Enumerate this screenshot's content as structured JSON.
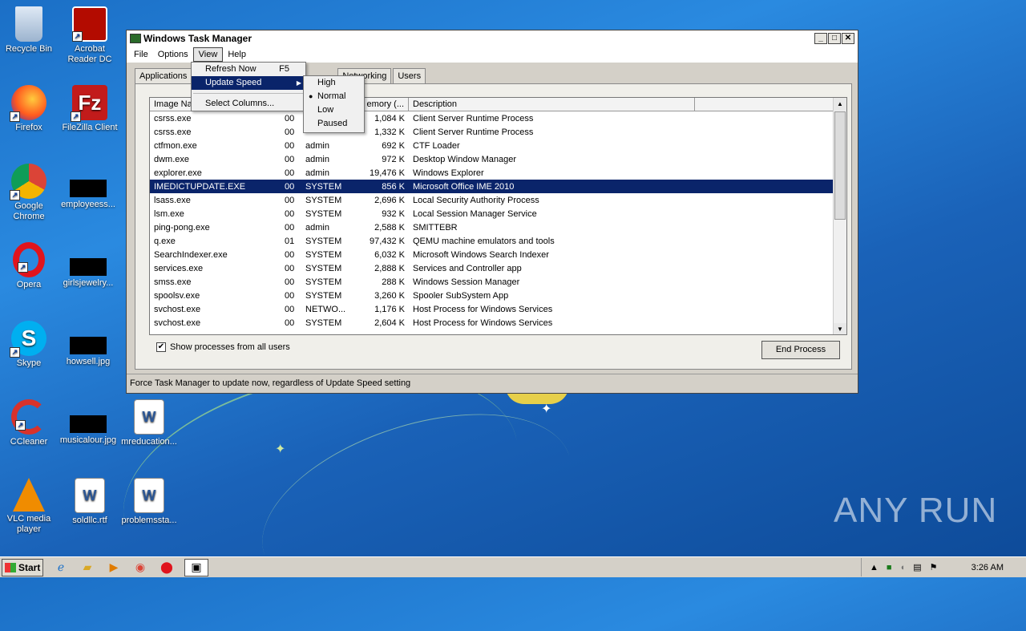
{
  "desktop": {
    "icons": [
      {
        "label": "Recycle Bin"
      },
      {
        "label": "Acrobat Reader DC"
      },
      {
        "label": "Firefox"
      },
      {
        "label": "FileZilla Client"
      },
      {
        "label": "Google Chrome"
      },
      {
        "label": "employeess..."
      },
      {
        "label": "Opera"
      },
      {
        "label": "girlsjewelry..."
      },
      {
        "label": "Skype"
      },
      {
        "label": "howsell.jpg"
      },
      {
        "label": "CCleaner"
      },
      {
        "label": "musicalour.jpg"
      },
      {
        "label": "mreducation..."
      },
      {
        "label": "VLC media player"
      },
      {
        "label": "soldllc.rtf"
      },
      {
        "label": "problemssta..."
      }
    ],
    "watermark": "ANY RUN"
  },
  "window": {
    "title": "Windows Task Manager",
    "menu": [
      "File",
      "Options",
      "View",
      "Help"
    ],
    "tabs": [
      "Applications",
      "Networking",
      "Users"
    ],
    "columns": [
      "Image Na",
      "emory (...",
      "Description"
    ],
    "rows": [
      {
        "name": "csrss.exe",
        "cpu": "00",
        "user": "",
        "mem": "1,084 K",
        "desc": "Client Server Runtime Process"
      },
      {
        "name": "csrss.exe",
        "cpu": "00",
        "user": "",
        "mem": "1,332 K",
        "desc": "Client Server Runtime Process"
      },
      {
        "name": "ctfmon.exe",
        "cpu": "00",
        "user": "admin",
        "mem": "692 K",
        "desc": "CTF Loader"
      },
      {
        "name": "dwm.exe",
        "cpu": "00",
        "user": "admin",
        "mem": "972 K",
        "desc": "Desktop Window Manager"
      },
      {
        "name": "explorer.exe",
        "cpu": "00",
        "user": "admin",
        "mem": "19,476 K",
        "desc": "Windows Explorer"
      },
      {
        "name": "IMEDICTUPDATE.EXE",
        "cpu": "00",
        "user": "SYSTEM",
        "mem": "856 K",
        "desc": "Microsoft Office IME 2010"
      },
      {
        "name": "lsass.exe",
        "cpu": "00",
        "user": "SYSTEM",
        "mem": "2,696 K",
        "desc": "Local Security Authority Process"
      },
      {
        "name": "lsm.exe",
        "cpu": "00",
        "user": "SYSTEM",
        "mem": "932 K",
        "desc": "Local Session Manager Service"
      },
      {
        "name": "ping-pong.exe",
        "cpu": "00",
        "user": "admin",
        "mem": "2,588 K",
        "desc": "SMITTEBR"
      },
      {
        "name": "q.exe",
        "cpu": "01",
        "user": "SYSTEM",
        "mem": "97,432 K",
        "desc": "QEMU machine emulators and tools"
      },
      {
        "name": "SearchIndexer.exe",
        "cpu": "00",
        "user": "SYSTEM",
        "mem": "6,032 K",
        "desc": "Microsoft Windows Search Indexer"
      },
      {
        "name": "services.exe",
        "cpu": "00",
        "user": "SYSTEM",
        "mem": "2,888 K",
        "desc": "Services and Controller app"
      },
      {
        "name": "smss.exe",
        "cpu": "00",
        "user": "SYSTEM",
        "mem": "288 K",
        "desc": "Windows Session Manager"
      },
      {
        "name": "spoolsv.exe",
        "cpu": "00",
        "user": "SYSTEM",
        "mem": "3,260 K",
        "desc": "Spooler SubSystem App"
      },
      {
        "name": "svchost.exe",
        "cpu": "00",
        "user": "NETWO...",
        "mem": "1,176 K",
        "desc": "Host Process for Windows Services"
      },
      {
        "name": "svchost.exe",
        "cpu": "00",
        "user": "SYSTEM",
        "mem": "2,604 K",
        "desc": "Host Process for Windows Services"
      }
    ],
    "show_all_label": "Show processes from all users",
    "end_process_label": "End Process",
    "status": "Force Task Manager to update now, regardless of Update Speed setting"
  },
  "view_menu": {
    "refresh": "Refresh Now",
    "refresh_key": "F5",
    "update_speed": "Update Speed",
    "select_columns": "Select Columns..."
  },
  "speed_menu": {
    "high": "High",
    "normal": "Normal",
    "low": "Low",
    "paused": "Paused"
  },
  "taskbar": {
    "start": "Start",
    "clock": "3:26 AM"
  }
}
